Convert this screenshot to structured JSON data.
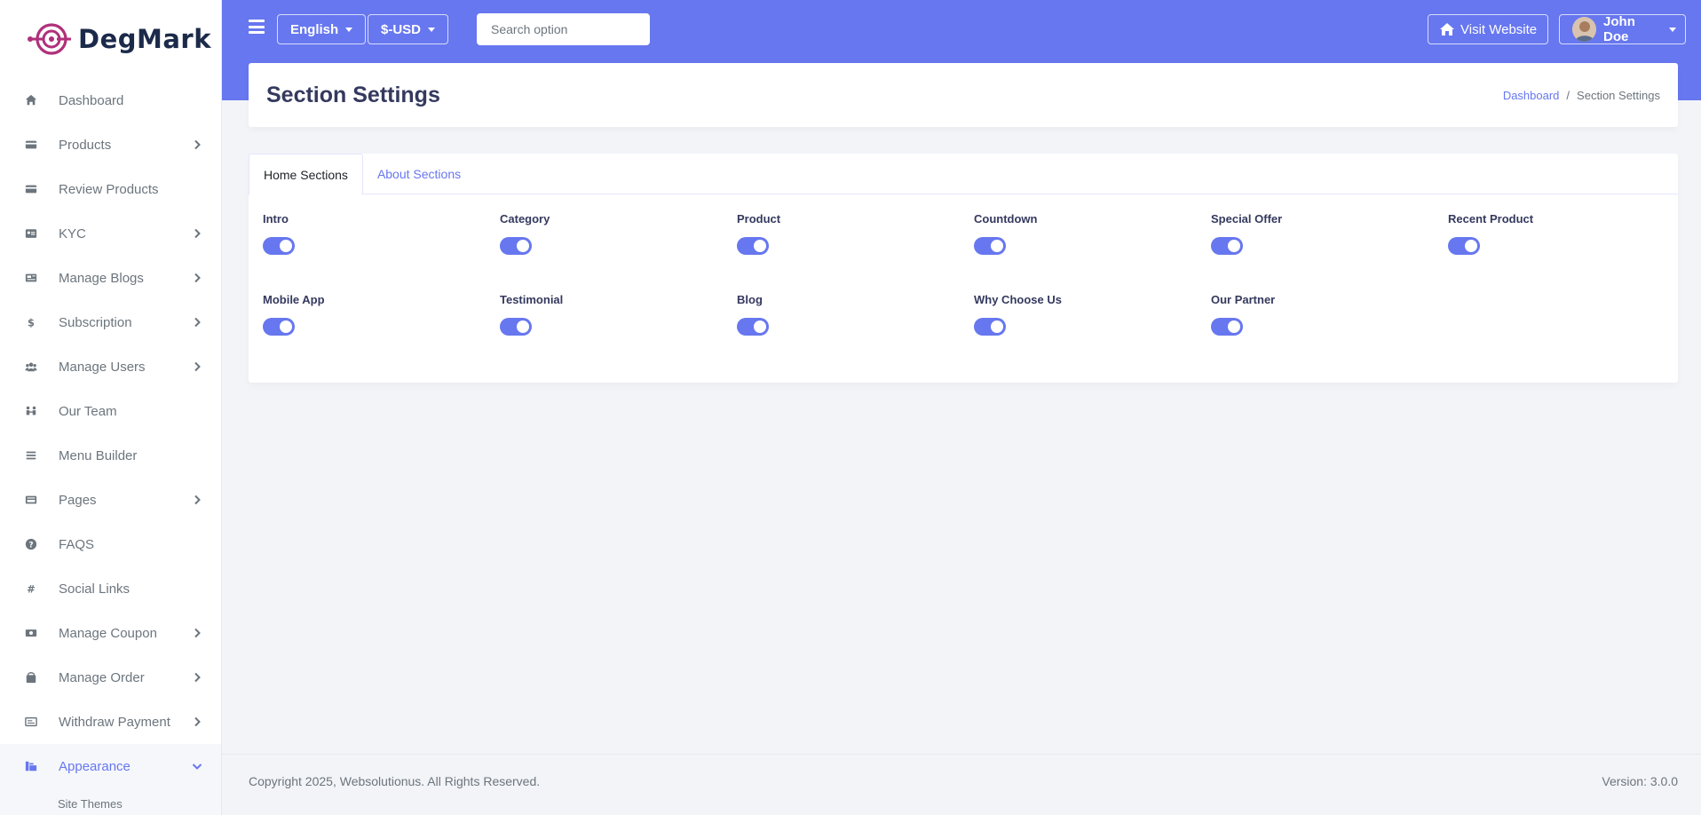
{
  "brand": {
    "name": "DegMark",
    "accent_color": "#6777ef",
    "logo_color": "#b0307a"
  },
  "sidebar": {
    "items": [
      {
        "label": "Dashboard",
        "icon": "home-icon",
        "has_children": false
      },
      {
        "label": "Products",
        "icon": "credit-card-icon",
        "has_children": true
      },
      {
        "label": "Review Products",
        "icon": "credit-card-icon",
        "has_children": false
      },
      {
        "label": "KYC",
        "icon": "id-card-icon",
        "has_children": true
      },
      {
        "label": "Manage Blogs",
        "icon": "newspaper-icon",
        "has_children": true
      },
      {
        "label": "Subscription",
        "icon": "dollar-icon",
        "has_children": true
      },
      {
        "label": "Manage Users",
        "icon": "users-icon",
        "has_children": true
      },
      {
        "label": "Our Team",
        "icon": "team-icon",
        "has_children": false
      },
      {
        "label": "Menu Builder",
        "icon": "bars-icon",
        "has_children": false
      },
      {
        "label": "Pages",
        "icon": "pages-icon",
        "has_children": true
      },
      {
        "label": "FAQS",
        "icon": "question-circle-icon",
        "has_children": false
      },
      {
        "label": "Social Links",
        "icon": "hashtag-icon",
        "has_children": false
      },
      {
        "label": "Manage Coupon",
        "icon": "money-icon",
        "has_children": true
      },
      {
        "label": "Manage Order",
        "icon": "shopping-bag-icon",
        "has_children": true
      },
      {
        "label": "Withdraw Payment",
        "icon": "money-check-icon",
        "has_children": true
      },
      {
        "label": "Appearance",
        "icon": "palette-icon",
        "has_children": true,
        "active": true
      }
    ],
    "subitems": [
      {
        "label": "Site Themes"
      }
    ]
  },
  "header": {
    "language": "English",
    "currency": "$-USD",
    "search_placeholder": "Search option",
    "visit_website": "Visit Website",
    "user_name": "John Doe"
  },
  "page": {
    "title": "Section Settings",
    "breadcrumb": [
      "Dashboard",
      "/",
      "Section Settings"
    ]
  },
  "tabs": [
    {
      "label": "Home Sections",
      "active": true
    },
    {
      "label": "About Sections",
      "active": false
    }
  ],
  "sections": [
    {
      "label": "Intro",
      "enabled": true
    },
    {
      "label": "Category",
      "enabled": true
    },
    {
      "label": "Product",
      "enabled": true
    },
    {
      "label": "Countdown",
      "enabled": true
    },
    {
      "label": "Special Offer",
      "enabled": true
    },
    {
      "label": "Recent Product",
      "enabled": true
    },
    {
      "label": "Mobile App",
      "enabled": true
    },
    {
      "label": "Testimonial",
      "enabled": true
    },
    {
      "label": "Blog",
      "enabled": true
    },
    {
      "label": "Why Choose Us",
      "enabled": true
    },
    {
      "label": "Our Partner",
      "enabled": true
    }
  ],
  "footer": {
    "copyright": "Copyright 2025, Websolutionus. All Rights Reserved.",
    "version": "Version: 3.0.0"
  }
}
